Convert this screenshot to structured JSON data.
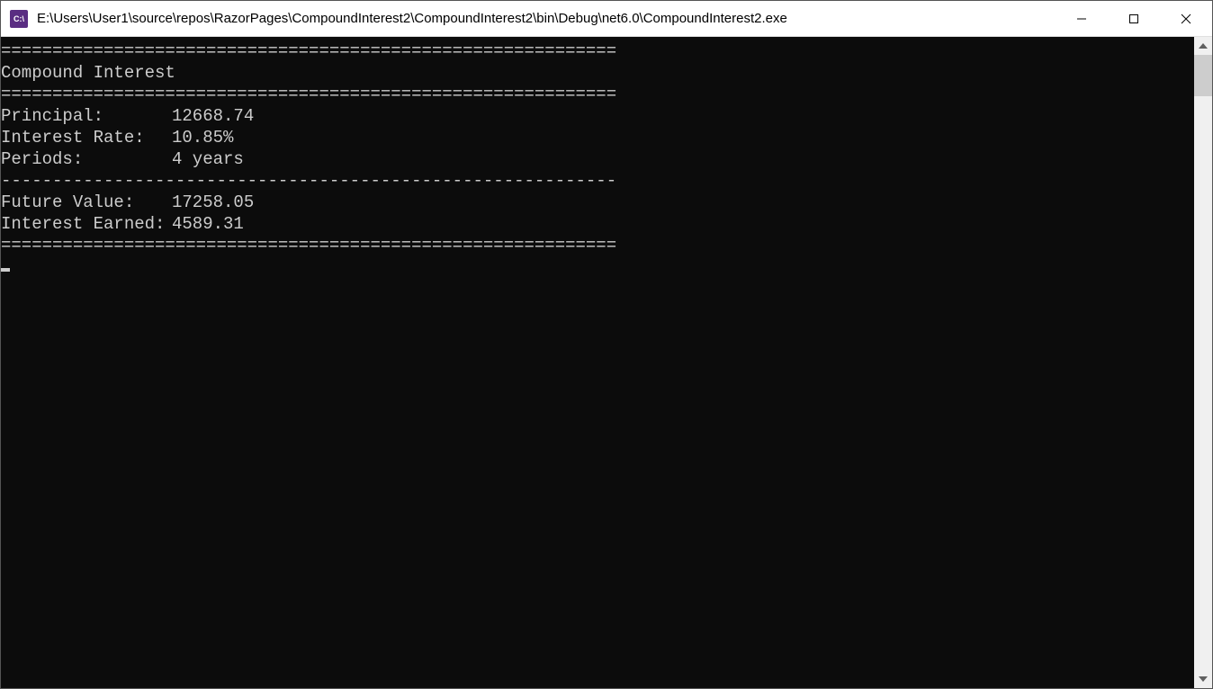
{
  "window": {
    "title": "E:\\Users\\User1\\source\\repos\\RazorPages\\CompoundInterest2\\CompoundInterest2\\bin\\Debug\\net6.0\\CompoundInterest2.exe",
    "icon_label": "C:\\"
  },
  "console": {
    "divider_double": "============================================================",
    "divider_single": "------------------------------------------------------------",
    "heading": "Compound Interest",
    "rows": {
      "principal_label": "Principal:",
      "principal_value": "12668.74",
      "rate_label": "Interest Rate:",
      "rate_value": "10.85%",
      "periods_label": "Periods:",
      "periods_value": "4 years",
      "future_label": "Future Value:",
      "future_value": "17258.05",
      "earned_label": "Interest Earned:",
      "earned_value": "4589.31"
    }
  }
}
